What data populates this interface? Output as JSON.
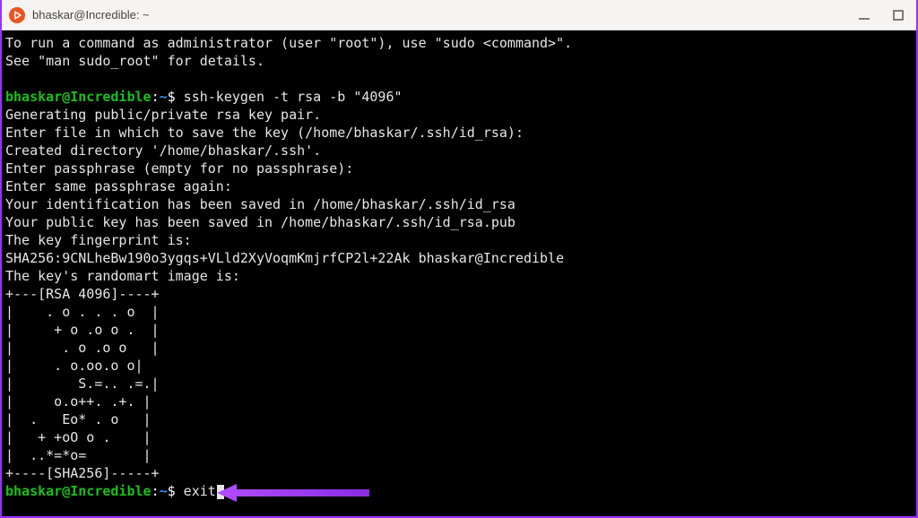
{
  "window": {
    "title": "bhaskar@Incredible: ~"
  },
  "prompt": {
    "userhost": "bhaskar@Incredible",
    "sep": ":",
    "path": "~",
    "dollar": "$"
  },
  "commands": {
    "cmd1": " ssh-keygen -t rsa -b \"4096\"",
    "cmd2": " exit"
  },
  "output": {
    "l0a": "To run a command as administrator (user \"root\"), use \"sudo <command>\".",
    "l0b": "See \"man sudo_root\" for details.",
    "blank": "",
    "l1": "Generating public/private rsa key pair.",
    "l2": "Enter file in which to save the key (/home/bhaskar/.ssh/id_rsa):",
    "l3": "Created directory '/home/bhaskar/.ssh'.",
    "l4": "Enter passphrase (empty for no passphrase):",
    "l5": "Enter same passphrase again:",
    "l6": "Your identification has been saved in /home/bhaskar/.ssh/id_rsa",
    "l7": "Your public key has been saved in /home/bhaskar/.ssh/id_rsa.pub",
    "l8": "The key fingerprint is:",
    "l9": "SHA256:9CNLheBw190o3ygqs+VLld2XyVoqmKmjrfCP2l+22Ak bhaskar@Incredible",
    "l10": "The key's randomart image is:",
    "ra0": "+---[RSA 4096]----+",
    "ra1": "|    . o . . . o  |",
    "ra2": "|     + o .o o .  |",
    "ra3": "|      . o .o o   |",
    "ra4": "|     . o.oo.o o|",
    "ra5": "|        S.=.. .=.|",
    "ra6": "|     o.o++. .+. |",
    "ra7": "|  .   Eo* . o   |",
    "ra8": "|   + +oO o .    |",
    "ra9": "|  ..*=*o=       |",
    "ra10": "+----[SHA256]-----+"
  }
}
